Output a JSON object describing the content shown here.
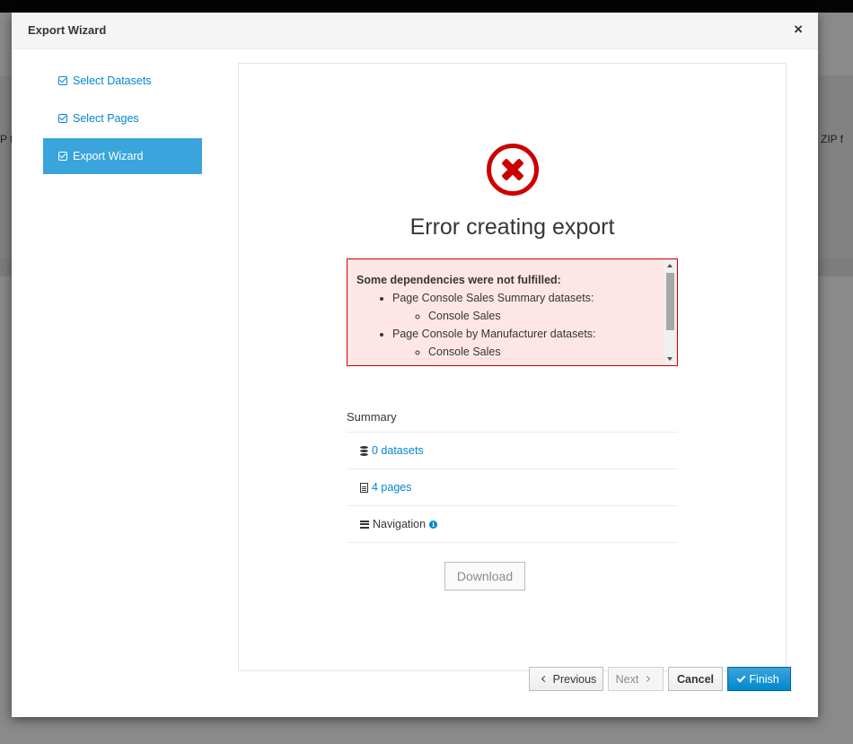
{
  "background": {
    "peek_left": "P f",
    "peek_right": "n a ZIP f"
  },
  "modal": {
    "title": "Export Wizard",
    "close_glyph": "×"
  },
  "steps": [
    {
      "label": "Select Datasets",
      "active": false
    },
    {
      "label": "Select Pages",
      "active": false
    },
    {
      "label": "Export Wizard",
      "active": true
    }
  ],
  "error": {
    "title": "Error creating export",
    "heading": "Some dependencies were not fulfilled:",
    "items": [
      {
        "page": "Page Console Sales Summary datasets:",
        "datasets": [
          "Console Sales"
        ]
      },
      {
        "page": "Page Console by Manufacturer datasets:",
        "datasets": [
          "Console Sales"
        ]
      }
    ]
  },
  "summary": {
    "label": "Summary",
    "datasets": "0 datasets",
    "pages": "4 pages",
    "navigation": "Navigation",
    "info_glyph": "i"
  },
  "buttons": {
    "download": "Download",
    "previous": "Previous",
    "next": "Next",
    "cancel": "Cancel",
    "finish": "Finish"
  },
  "colors": {
    "accent": "#0088ce",
    "active_step": "#39a5dc",
    "error": "#cc0000",
    "error_bg": "#ffe6e6"
  }
}
